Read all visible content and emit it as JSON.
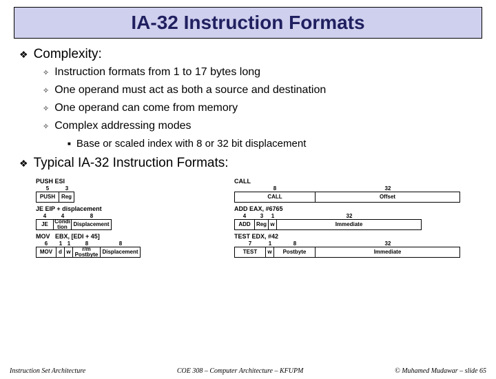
{
  "title": "IA-32 Instruction Formats",
  "sec1": {
    "head": "Complexity:",
    "items": [
      "Instruction formats from 1 to 17 bytes long",
      "One operand must act as both a source and destination",
      "One operand can come from memory",
      "Complex addressing modes"
    ],
    "sub": "Base or scaled index with 8 or 32 bit displacement"
  },
  "sec2": {
    "head": "Typical IA-32 Instruction Formats:"
  },
  "d": {
    "push": {
      "label": "PUSH ESI",
      "w": [
        "5",
        "3"
      ],
      "c": [
        "PUSH",
        "Reg"
      ]
    },
    "call": {
      "label": "CALL",
      "w": [
        "8",
        "32"
      ],
      "c": [
        "CALL",
        "Offset"
      ]
    },
    "je": {
      "label": "JE EIP + displacement",
      "w": [
        "4",
        "4",
        "8"
      ],
      "c": [
        "JE",
        "Condi\ntion",
        "Displacement"
      ]
    },
    "add": {
      "label": "ADD EAX, #6765",
      "w": [
        "4",
        "3",
        "1",
        "32"
      ],
      "c": [
        "ADD",
        "Reg",
        "w",
        "Immediate"
      ]
    },
    "mov": {
      "label": "MOV   EBX, [EDI + 45]",
      "w": [
        "6",
        "1",
        "1",
        "8",
        "8"
      ],
      "c": [
        "MOV",
        "d",
        "w",
        "r/m\nPostbyte",
        "Displacement"
      ]
    },
    "test": {
      "label": "TEST EDX, #42",
      "w": [
        "7",
        "1",
        "8",
        "32"
      ],
      "c": [
        "TEST",
        "w",
        "Postbyte",
        "Immediate"
      ]
    }
  },
  "footer": {
    "left": "Instruction Set Architecture",
    "mid": "COE 308 – Computer Architecture – KFUPM",
    "right": "© Muhamed Mudawar – slide 65"
  }
}
